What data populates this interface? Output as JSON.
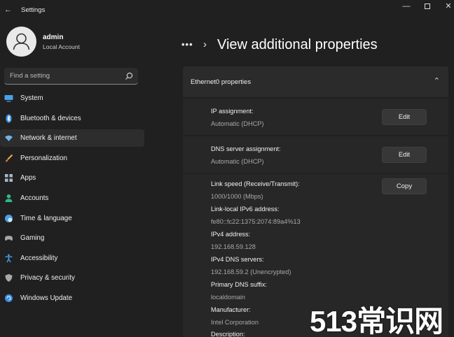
{
  "window": {
    "title": "Settings",
    "back": "←",
    "minimize": "—",
    "close": "✕"
  },
  "user": {
    "name": "admin",
    "account_type": "Local Account"
  },
  "search": {
    "placeholder": "Find a setting"
  },
  "sidebar": {
    "items": [
      {
        "label": "System",
        "icon": "monitor-icon",
        "color": "#4aa0e6"
      },
      {
        "label": "Bluetooth & devices",
        "icon": "bluetooth-icon",
        "color": "#3b8fe0"
      },
      {
        "label": "Network & internet",
        "icon": "wifi-icon",
        "color": "#6fb3ea",
        "active": true
      },
      {
        "label": "Personalization",
        "icon": "brush-icon",
        "color": "#e7a94c"
      },
      {
        "label": "Apps",
        "icon": "apps-icon",
        "color": "#a9b7c7"
      },
      {
        "label": "Accounts",
        "icon": "person-icon",
        "color": "#2fb88c"
      },
      {
        "label": "Time & language",
        "icon": "globe-clock-icon",
        "color": "#4aa0e6"
      },
      {
        "label": "Gaming",
        "icon": "gamepad-icon",
        "color": "#a8a8a8"
      },
      {
        "label": "Accessibility",
        "icon": "accessibility-icon",
        "color": "#4aa0e6"
      },
      {
        "label": "Privacy & security",
        "icon": "shield-icon",
        "color": "#a8a8a8"
      },
      {
        "label": "Windows Update",
        "icon": "update-icon",
        "color": "#3b8fe0"
      }
    ]
  },
  "breadcrumb": {
    "dots": "•••",
    "chevron": "›",
    "title": "View additional properties"
  },
  "card": {
    "header": "Ethernet0 properties",
    "chevron": "⌃",
    "ip": {
      "label": "IP assignment:",
      "value": "Automatic (DHCP)",
      "button": "Edit"
    },
    "dns": {
      "label": "DNS server assignment:",
      "value": "Automatic (DHCP)",
      "button": "Edit"
    },
    "details": {
      "button": "Copy",
      "fields": [
        {
          "label": "Link speed (Receive/Transmit):",
          "value": "1000/1000 (Mbps)"
        },
        {
          "label": "Link-local IPv6 address:",
          "value": "fe80::fc22:1375:2074:89a4%13"
        },
        {
          "label": "IPv4 address:",
          "value": "192.168.59.128"
        },
        {
          "label": "IPv4 DNS servers:",
          "value": "192.168.59.2 (Unencrypted)"
        },
        {
          "label": "Primary DNS suffix:",
          "value": "localdomain"
        },
        {
          "label": "Manufacturer:",
          "value": "Intel Corporation"
        },
        {
          "label": "Description:",
          "value": ""
        }
      ]
    }
  },
  "watermark": "513常识网"
}
